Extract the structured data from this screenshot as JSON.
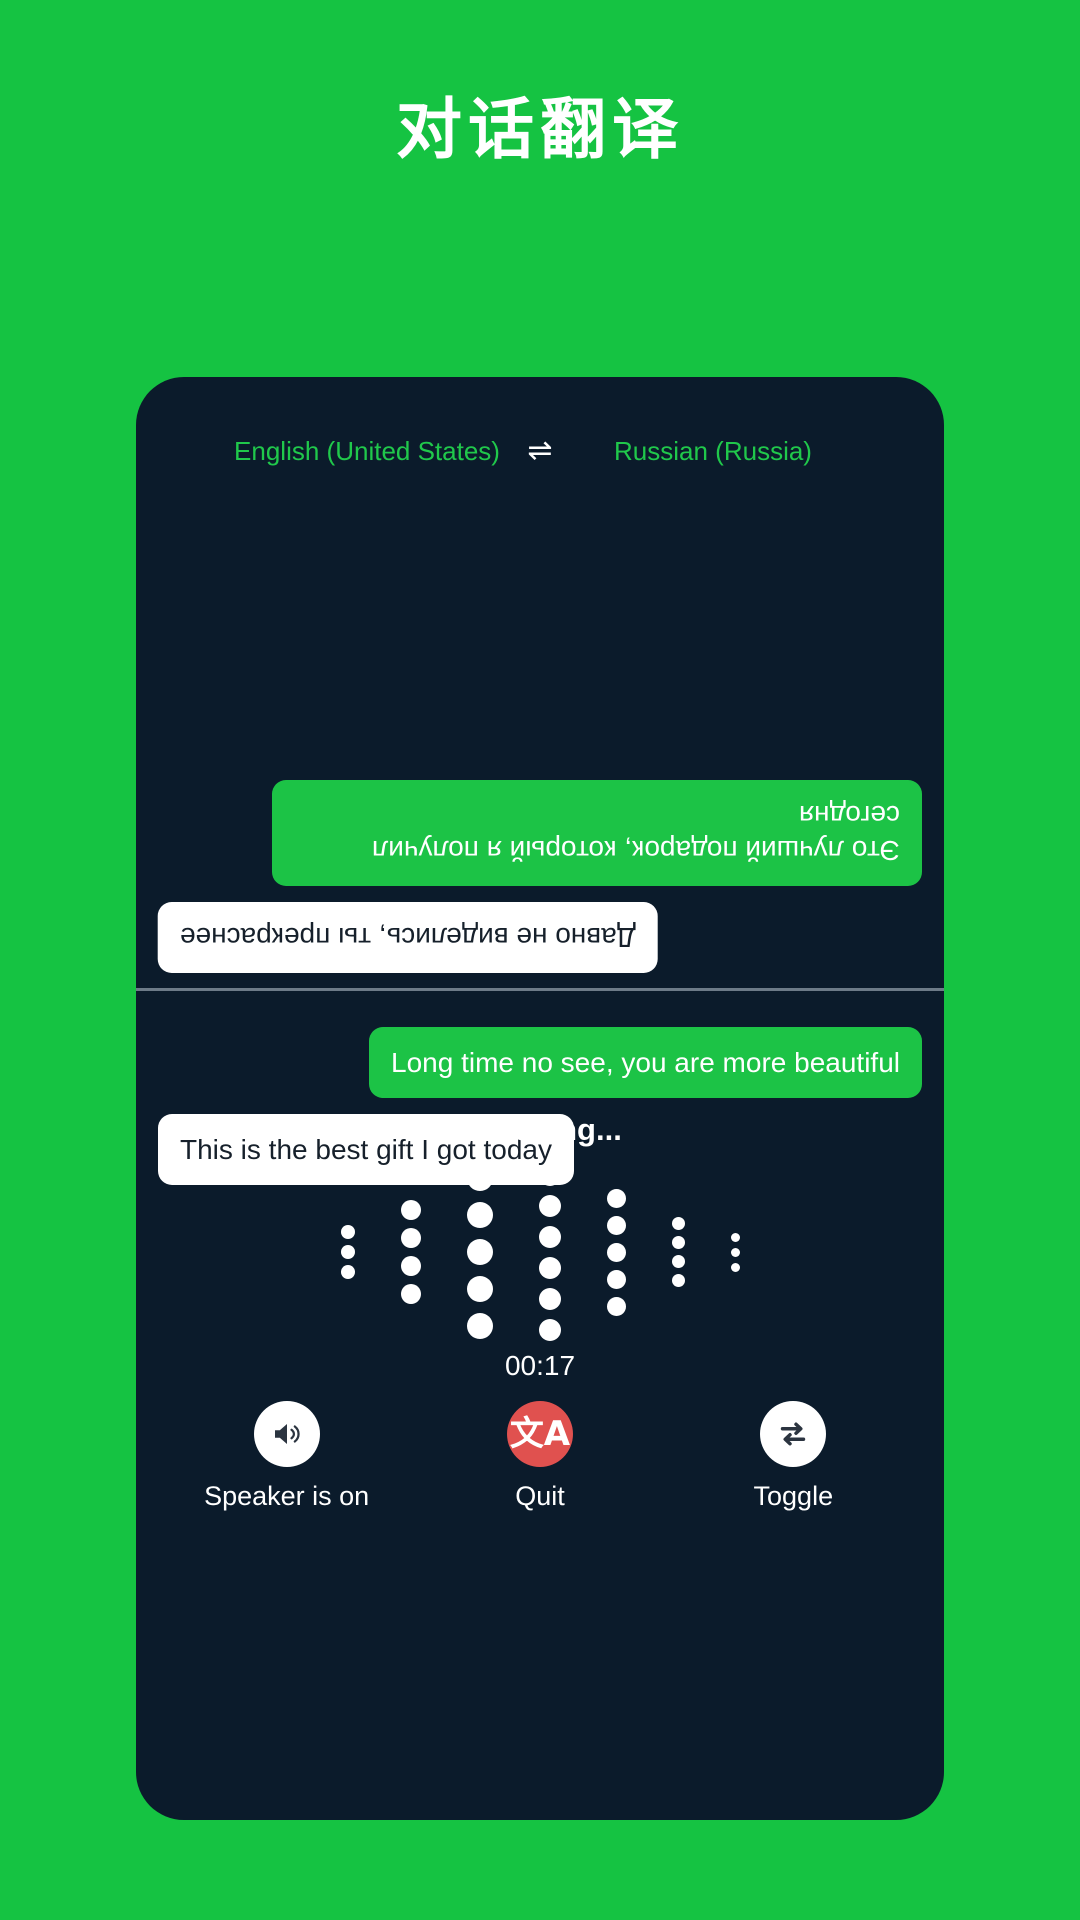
{
  "page": {
    "title": "对话翻译",
    "background_color": "#15c342",
    "panel_color": "#0b1b2b",
    "accent_green": "#1cc346",
    "accent_red": "#e0514f"
  },
  "language_bar": {
    "source_language": "English (United States)",
    "target_language": "Russian (Russia)",
    "swap_icon": "swap-horizontal-icon",
    "swap_glyph": "⇌"
  },
  "conversation": {
    "top_pane": [
      {
        "text": "Это лучший подарок, который я получил сегодня",
        "align": "right",
        "style": "green",
        "language": "Russian"
      },
      {
        "text": "Давно не виделись, ты прекраснее",
        "align": "left",
        "style": "white",
        "language": "Russian"
      }
    ],
    "bottom_pane": [
      {
        "text": "Long time no see, you are more beautiful",
        "align": "right",
        "style": "green",
        "language": "English"
      },
      {
        "text": "This is the best gift I got today",
        "align": "left",
        "style": "white",
        "language": "English"
      }
    ]
  },
  "status": {
    "listening_label": "Listening...",
    "timer": "00:17"
  },
  "waveform": {
    "columns": [
      {
        "count": 3,
        "size": 14
      },
      {
        "count": 4,
        "size": 20
      },
      {
        "count": 5,
        "size": 26
      },
      {
        "count": 6,
        "size": 22
      },
      {
        "count": 5,
        "size": 19
      },
      {
        "count": 4,
        "size": 13
      },
      {
        "count": 3,
        "size": 9
      }
    ],
    "dot_color": "#ffffff"
  },
  "controls": [
    {
      "label": "Speaker is on",
      "icon": "speaker-on-icon",
      "circle_style": "white",
      "name": "speaker-button"
    },
    {
      "label": "Quit",
      "icon": "translate-icon",
      "glyph": "文A",
      "circle_style": "red",
      "name": "quit-button"
    },
    {
      "label": "Toggle",
      "icon": "swap-repeat-icon",
      "circle_style": "white",
      "name": "toggle-button"
    }
  ]
}
